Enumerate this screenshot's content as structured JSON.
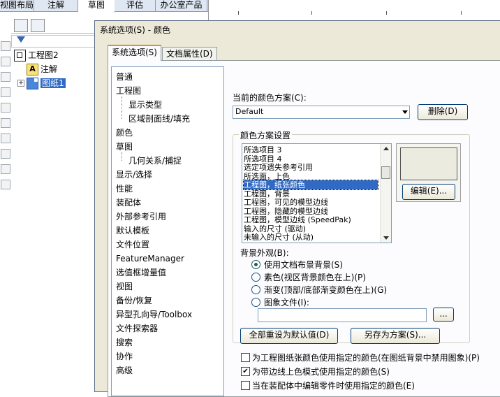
{
  "ribbon": {
    "tabs": [
      "视图布局",
      "注解",
      "草图",
      "评估",
      "办公室产品"
    ],
    "active": "草图"
  },
  "tree": {
    "root": "工程图2",
    "annotation": "注解",
    "sheet": "图纸1"
  },
  "dialog": {
    "title": "系统选项(S) - 颜色",
    "tabs": [
      "系统选项(S)",
      "文档属性(D)"
    ],
    "nav": [
      {
        "label": "普通",
        "level": 1
      },
      {
        "label": "工程图",
        "level": 1
      },
      {
        "label": "显示类型",
        "level": 2
      },
      {
        "label": "区域剖面线/填充",
        "level": 2
      },
      {
        "label": "颜色",
        "level": 1
      },
      {
        "label": "草图",
        "level": 1
      },
      {
        "label": "几何关系/捕捉",
        "level": 2
      },
      {
        "label": "显示/选择",
        "level": 1
      },
      {
        "label": "性能",
        "level": 1
      },
      {
        "label": "装配体",
        "level": 1
      },
      {
        "label": "外部参考引用",
        "level": 1
      },
      {
        "label": "默认模板",
        "level": 1
      },
      {
        "label": "文件位置",
        "level": 1
      },
      {
        "label": "FeatureManager",
        "level": 1
      },
      {
        "label": "选值框增量值",
        "level": 1
      },
      {
        "label": "视图",
        "level": 1
      },
      {
        "label": "备份/恢复",
        "level": 1
      },
      {
        "label": "异型孔向导/Toolbox",
        "level": 1
      },
      {
        "label": "文件探索器",
        "level": 1
      },
      {
        "label": "搜索",
        "level": 1
      },
      {
        "label": "协作",
        "level": 1
      },
      {
        "label": "高级",
        "level": 1
      }
    ],
    "scheme_label": "当前的颜色方案(C):",
    "scheme_value": "Default",
    "delete_button": "删除(D)",
    "group_title": "颜色方案设置",
    "color_items": [
      "所选项目 3",
      "所选项目 4",
      "选定项遗失参考引用",
      "所选面，上色",
      "工程图，纸张颜色",
      "工程图，背景",
      "工程图，可见的模型边线",
      "工程图，隐藏的模型边线",
      "工程图，模型边线 (SpeedPak)",
      "输入的尺寸 (驱动)",
      "未输入的尺寸 (从动)"
    ],
    "selected_color_item": "工程图，纸张颜色",
    "swatch_color": "#ecebdf",
    "edit_button": "编辑(E)...",
    "background_label": "背景外观(B):",
    "background_options": [
      {
        "label": "使用文档布景背景(S)",
        "checked": true
      },
      {
        "label": "素色(视区背景颜色在上)(P)",
        "checked": false
      },
      {
        "label": "渐变(顶部/底部渐变颜色在上)(G)",
        "checked": false
      },
      {
        "label": "图象文件(I):",
        "checked": false
      }
    ],
    "image_file_value": "",
    "browse_button": "...",
    "reset_button": "全部重设为默认值(D)",
    "saveas_button": "另存为方案(S)...",
    "checkboxes": [
      {
        "label": "为工程图纸张颜色使用指定的颜色(在图纸背景中禁用图象)(P)",
        "checked": false
      },
      {
        "label": "为带边线上色模式使用指定的颜色(S)",
        "checked": true
      },
      {
        "label": "当在装配体中编辑零件时使用指定的颜色(E)",
        "checked": false
      }
    ]
  }
}
